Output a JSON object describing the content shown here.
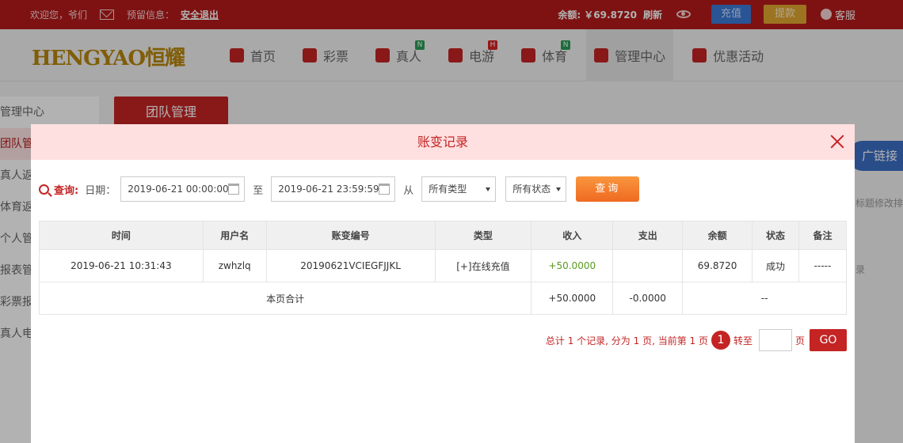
{
  "topbar": {
    "welcome": "欢迎您，爷们",
    "reserved_label": "预留信息：",
    "logout": "安全退出",
    "balance": "余额: ￥69.8720",
    "refresh": "刷新",
    "recharge": "充值",
    "withdraw": "提款",
    "service": "客服"
  },
  "logo": "HENGYAO恒耀",
  "nav": [
    {
      "label": "首页"
    },
    {
      "label": "彩票"
    },
    {
      "label": "真人",
      "badge": "N"
    },
    {
      "label": "电游",
      "badge": "H"
    },
    {
      "label": "体育",
      "badge": "N"
    },
    {
      "label": "管理中心"
    },
    {
      "label": "优惠活动"
    }
  ],
  "sidebar": [
    "管理中心",
    "团队管",
    "真人返",
    "体育返",
    "个人管",
    "报表管",
    "彩票报",
    "真人电"
  ],
  "team_tab": "团队管理",
  "promo": "广链接",
  "right_note": "标题修改排",
  "right_link": "录",
  "modal": {
    "title": "账变记录",
    "query": {
      "label": "查询:",
      "date_label": "日期：",
      "start": "2019-06-21 00:00:00",
      "to": "至",
      "end": "2019-06-21 23:59:59",
      "from": "从",
      "type": "所有类型",
      "status": "所有状态",
      "button": "查询"
    },
    "table": {
      "headers": [
        "时间",
        "用户名",
        "账变编号",
        "类型",
        "收入",
        "支出",
        "余额",
        "状态",
        "备注"
      ],
      "row": {
        "time": "2019-06-21 10:31:43",
        "user": "zwhzlq",
        "id": "20190621VCIEGFJJKL",
        "type": "[+]在线充值",
        "income": "+50.0000",
        "expense": "",
        "balance": "69.8720",
        "status": "成功",
        "note": "-----"
      },
      "total": {
        "label": "本页合计",
        "income": "+50.0000",
        "expense": "-0.0000",
        "rest": "--"
      }
    },
    "pager": {
      "summary": "总计 1 个记录, 分为 1 页, 当前第 1 页",
      "current": "1",
      "goto": "转至",
      "page_unit": "页",
      "go": "GO"
    }
  }
}
